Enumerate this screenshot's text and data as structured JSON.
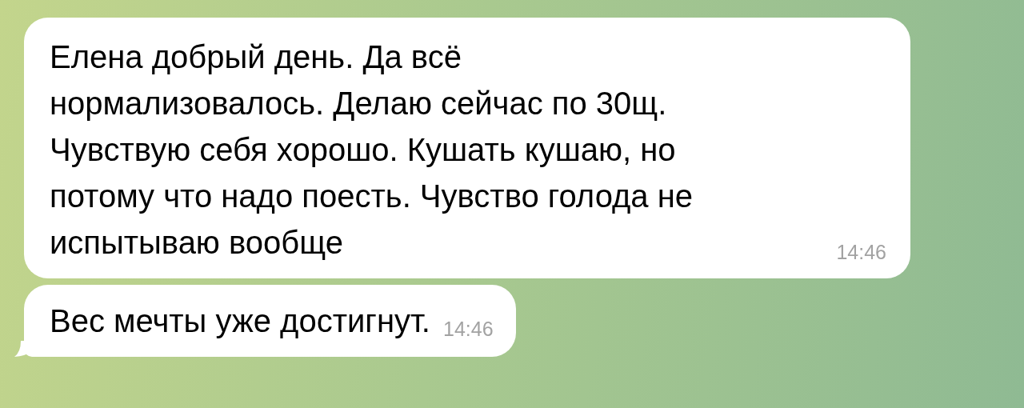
{
  "messages": [
    {
      "tail": false,
      "text": "Елена добрый день. Да всё\nнормализовалось. Делаю сейчас по 30щ.\nЧувствую себя хорошо. Кушать кушаю, но\nпотому что надо поесть. Чувство голода не\nиспытываю вообще",
      "time": "14:46"
    },
    {
      "tail": true,
      "text": "Вес мечты уже достигнут.",
      "time": "14:46"
    }
  ]
}
